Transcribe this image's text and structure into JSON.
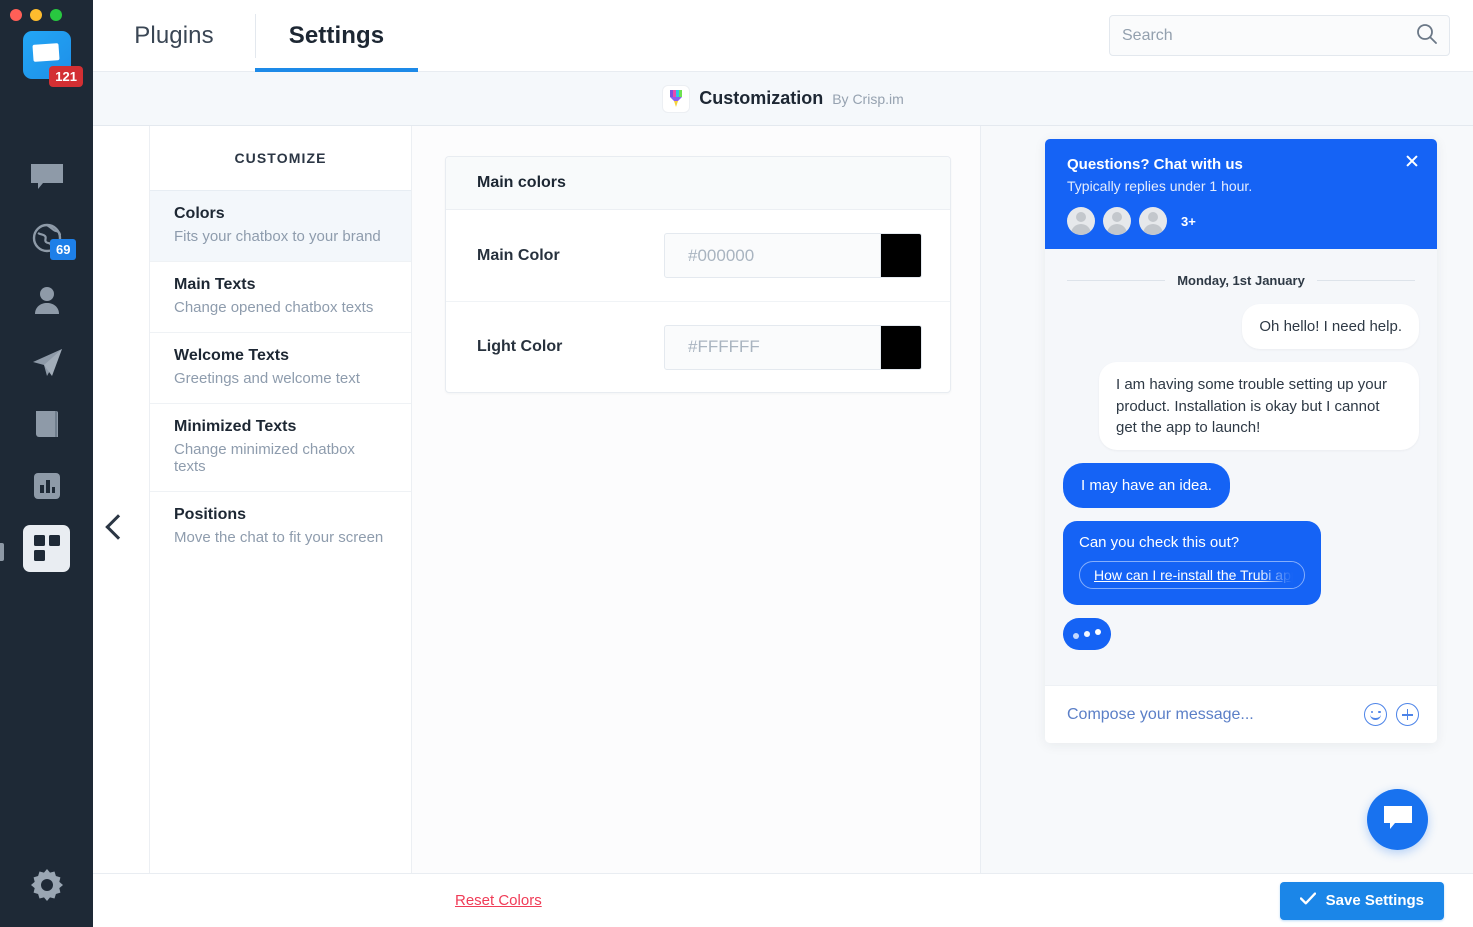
{
  "window": {
    "traffic_lights": [
      "close",
      "minimize",
      "zoom"
    ]
  },
  "rail": {
    "app_badge": "121",
    "items": [
      {
        "icon": "chat-bubble-icon",
        "label": "Conversations",
        "badge": ""
      },
      {
        "icon": "globe-icon",
        "label": "Visitors",
        "badge": "69"
      },
      {
        "icon": "person-icon",
        "label": "Contacts",
        "badge": ""
      },
      {
        "icon": "paper-plane-icon",
        "label": "Campaigns",
        "badge": ""
      },
      {
        "icon": "book-icon",
        "label": "Helpdesk",
        "badge": ""
      },
      {
        "icon": "bar-chart-icon",
        "label": "Analytics",
        "badge": ""
      },
      {
        "icon": "plugins-grid-icon",
        "label": "Plugins",
        "badge": ""
      }
    ],
    "settings_icon": "gear-icon"
  },
  "header": {
    "tabs": [
      {
        "label": "Plugins",
        "active": false
      },
      {
        "label": "Settings",
        "active": true
      }
    ],
    "search": {
      "placeholder": "Search",
      "value": "",
      "icon": "search-icon"
    }
  },
  "plugin_bar": {
    "icon": "paintbrush-icon",
    "title": "Customization",
    "author": "By Crisp.im"
  },
  "customize": {
    "heading": "CUSTOMIZE",
    "collapse_icon": "chevron-left-icon",
    "items": [
      {
        "title": "Colors",
        "subtitle": "Fits your chatbox to your brand",
        "selected": true
      },
      {
        "title": "Main Texts",
        "subtitle": "Change opened chatbox texts",
        "selected": false
      },
      {
        "title": "Welcome Texts",
        "subtitle": "Greetings and welcome text",
        "selected": false
      },
      {
        "title": "Minimized Texts",
        "subtitle": "Change minimized chatbox texts",
        "selected": false
      },
      {
        "title": "Positions",
        "subtitle": "Move the chat to fit your screen",
        "selected": false
      }
    ]
  },
  "panel": {
    "card_title": "Main colors",
    "rows": [
      {
        "label": "Main Color",
        "placeholder": "#000000",
        "value": "",
        "swatch": "#000000"
      },
      {
        "label": "Light Color",
        "placeholder": "#FFFFFF",
        "value": "",
        "swatch": "#000000"
      }
    ]
  },
  "preview": {
    "chatbox": {
      "header_title": "Questions? Chat with us",
      "header_subtitle": "Typically replies under 1 hour.",
      "avatar_more": "3+",
      "close_icon": "close-icon",
      "day_separator": "Monday, 1st January",
      "messages": [
        {
          "side": "right",
          "kind": "text",
          "text": "Oh hello! I need help."
        },
        {
          "side": "right",
          "kind": "text",
          "text": "I am having some trouble setting up your product. Installation is okay but I cannot get the app to launch!"
        },
        {
          "side": "left",
          "kind": "agent",
          "text": "I may have an idea."
        },
        {
          "side": "left",
          "kind": "card",
          "text": "Can you check this out?",
          "link": "How can I re-install the Trubi app"
        },
        {
          "side": "left",
          "kind": "typing",
          "text": ""
        }
      ],
      "compose_placeholder": "Compose your message...",
      "compose_icons": [
        "smiley-icon",
        "plus-icon"
      ]
    },
    "fab_icon": "chat-bubble-icon"
  },
  "footer": {
    "reset_label": "Reset Colors",
    "save_label": "Save Settings",
    "save_icon": "check-icon"
  },
  "colors": {
    "brand_blue": "#1563f5",
    "tab_accent": "#1d8ae8",
    "rail_bg": "#1e2936",
    "danger_red": "#f03c57",
    "save_blue": "#1b86e8"
  }
}
